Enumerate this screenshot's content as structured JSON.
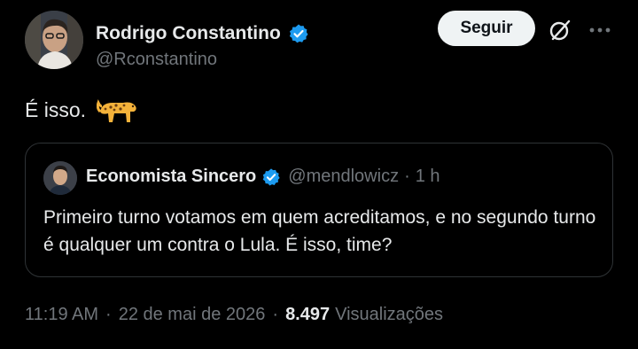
{
  "author": {
    "name": "Rodrigo Constantino",
    "handle": "@Rconstantino"
  },
  "actions": {
    "follow_label": "Seguir",
    "grok_icon": "grok-icon",
    "more_icon": "more-icon"
  },
  "tweet": {
    "text": "É isso.",
    "emoji": "leopard"
  },
  "quote": {
    "name": "Economista Sincero",
    "handle": "@mendlowicz",
    "separator": "·",
    "time": "1 h",
    "text": "Primeiro turno votamos em quem acreditamos, e no segundo turno é qualquer um contra o Lula. É isso, time?"
  },
  "meta": {
    "time": "11:19 AM",
    "separator": "·",
    "date": "22 de mai de 2026",
    "views_count": "8.497",
    "views_label": "Visualizações"
  },
  "colors": {
    "background": "#000000",
    "text": "#e7e9ea",
    "muted": "#71767b",
    "verified": "#1d9bf0",
    "border": "#2f3336"
  }
}
